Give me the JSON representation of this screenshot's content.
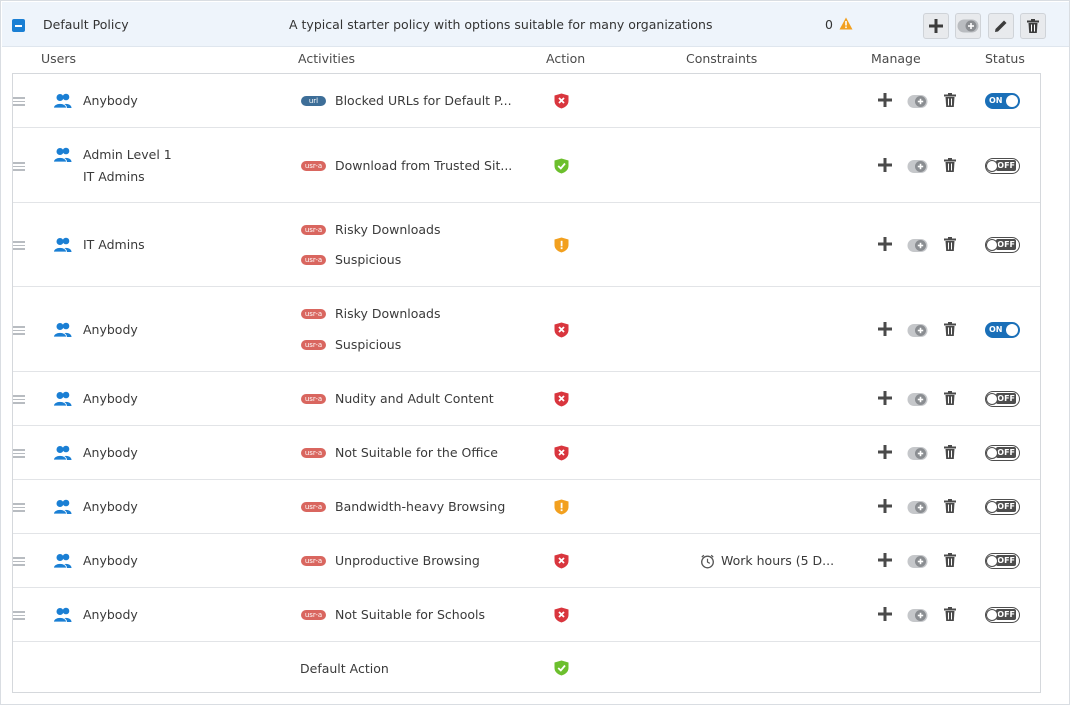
{
  "policy": {
    "name": "Default Policy",
    "description": "A typical starter policy with options suitable for many organizations",
    "warning_count": "0",
    "buttons": [
      "add-icon",
      "toggle-icon",
      "edit-icon",
      "trash-icon"
    ]
  },
  "columns": {
    "users": "Users",
    "activities": "Activities",
    "action": "Action",
    "constraints": "Constraints",
    "manage": "Manage",
    "status": "Status"
  },
  "badges": {
    "usr": "usr-a",
    "url": "url"
  },
  "colors": {
    "accent": "#1a7fd4",
    "block": "#d9363e",
    "allow": "#6cbf2d",
    "warn": "#f2a01f",
    "status_on": "#1a6fb8"
  },
  "status_labels": {
    "on": "ON",
    "off": "OFF"
  },
  "rules": [
    {
      "users": [
        "Anybody"
      ],
      "activities": [
        {
          "badge": "url",
          "label": "Blocked URLs for Default P..."
        }
      ],
      "action": "block",
      "constraint": "",
      "status": "on"
    },
    {
      "users": [
        "Admin Level 1",
        "IT Admins"
      ],
      "activities": [
        {
          "badge": "usr",
          "label": "Download from Trusted Sit..."
        }
      ],
      "action": "allow",
      "constraint": "",
      "status": "off"
    },
    {
      "users": [
        "IT Admins"
      ],
      "activities": [
        {
          "badge": "usr",
          "label": "Risky Downloads"
        },
        {
          "badge": "usr",
          "label": "Suspicious"
        }
      ],
      "action": "warn",
      "constraint": "",
      "status": "off"
    },
    {
      "users": [
        "Anybody"
      ],
      "activities": [
        {
          "badge": "usr",
          "label": "Risky Downloads"
        },
        {
          "badge": "usr",
          "label": "Suspicious"
        }
      ],
      "action": "block",
      "constraint": "",
      "status": "on"
    },
    {
      "users": [
        "Anybody"
      ],
      "activities": [
        {
          "badge": "usr",
          "label": "Nudity and Adult Content"
        }
      ],
      "action": "block",
      "constraint": "",
      "status": "off"
    },
    {
      "users": [
        "Anybody"
      ],
      "activities": [
        {
          "badge": "usr",
          "label": "Not Suitable for the Office"
        }
      ],
      "action": "block",
      "constraint": "",
      "status": "off"
    },
    {
      "users": [
        "Anybody"
      ],
      "activities": [
        {
          "badge": "usr",
          "label": "Bandwidth-heavy Browsing"
        }
      ],
      "action": "warn",
      "constraint": "",
      "status": "off"
    },
    {
      "users": [
        "Anybody"
      ],
      "activities": [
        {
          "badge": "usr",
          "label": "Unproductive Browsing"
        }
      ],
      "action": "block",
      "constraint": "Work hours (5 D...",
      "status": "off"
    },
    {
      "users": [
        "Anybody"
      ],
      "activities": [
        {
          "badge": "usr",
          "label": "Not Suitable for Schools"
        }
      ],
      "action": "block",
      "constraint": "",
      "status": "off"
    }
  ],
  "default_row": {
    "label": "Default Action",
    "action": "allow"
  }
}
